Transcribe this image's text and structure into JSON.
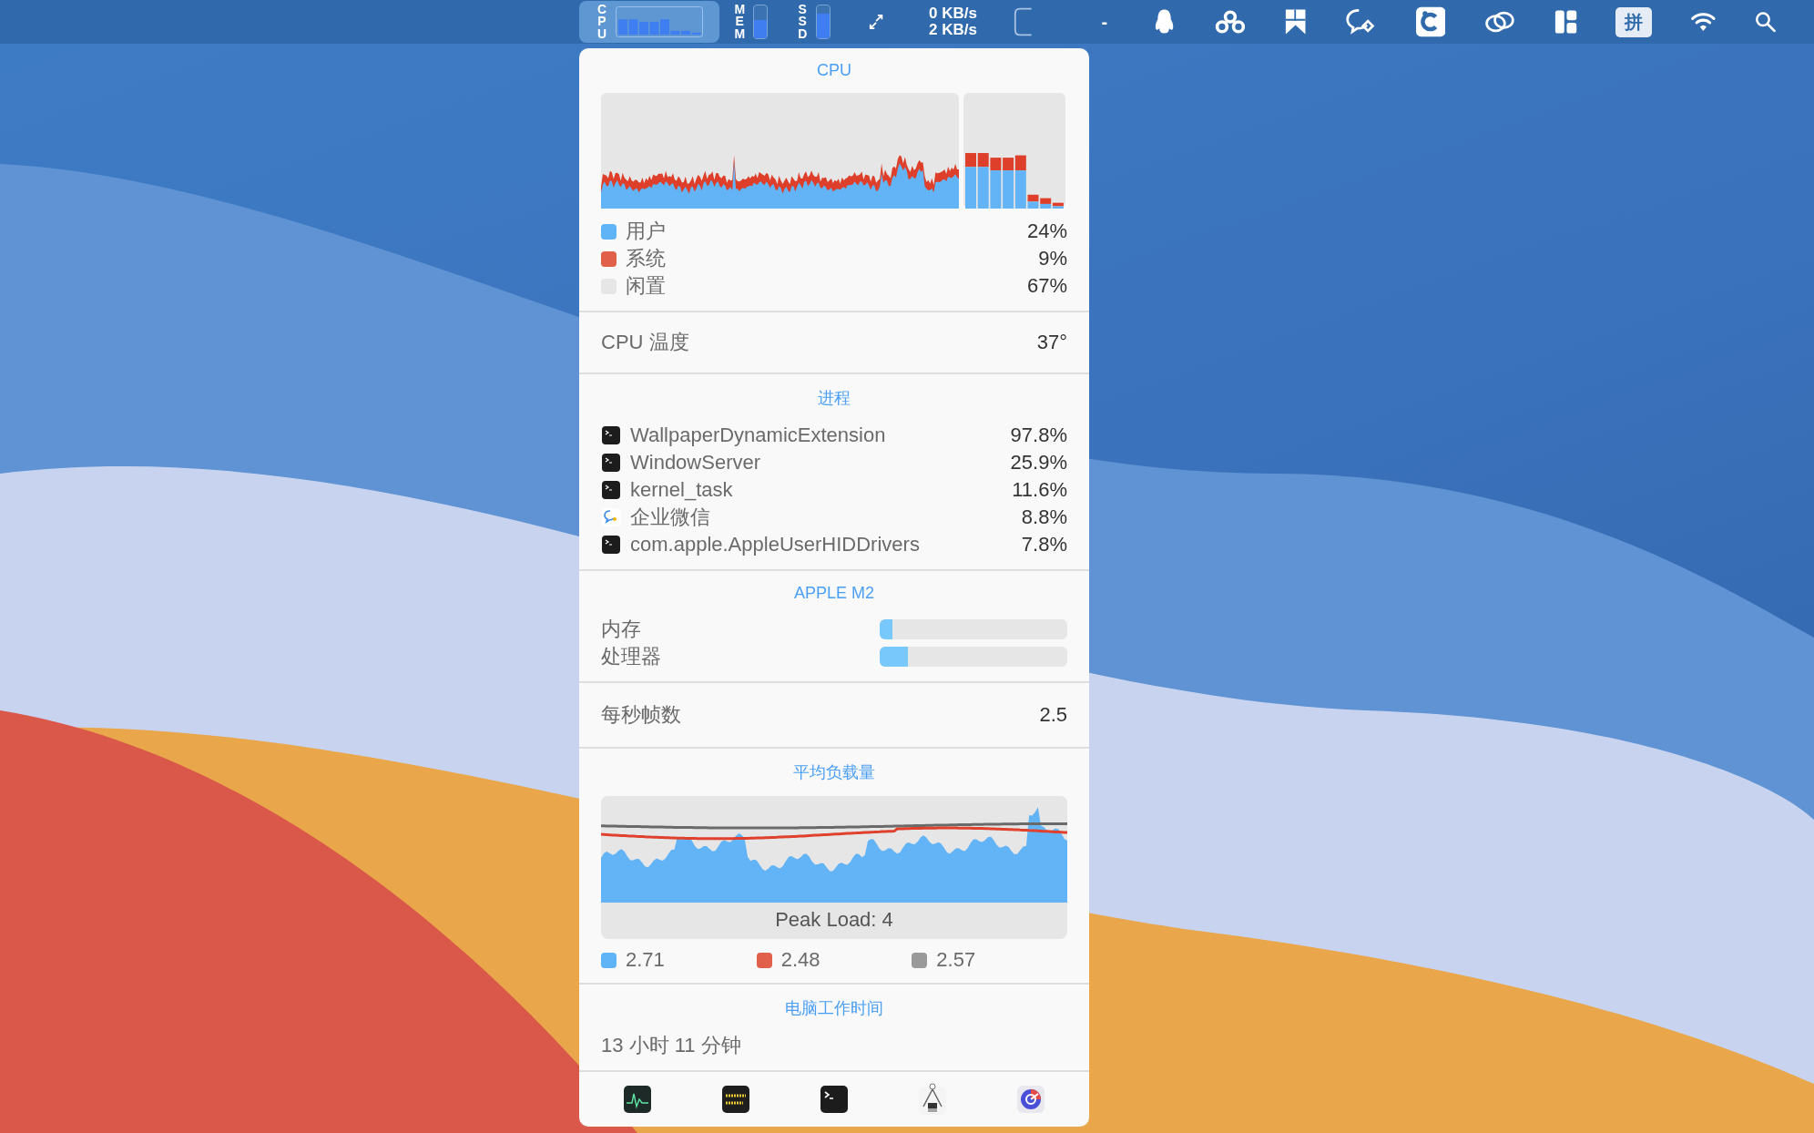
{
  "menu_bar": {
    "cpu": {
      "label": "CPU"
    },
    "mem": {
      "label": "MEM",
      "level": 0.55
    },
    "ssd": {
      "label": "SSD",
      "level": 0.75
    },
    "network": {
      "upload": "0 KB/s",
      "download": "2 KB/s"
    },
    "dash": "-",
    "input_method": "拼"
  },
  "panel": {
    "cpu": {
      "title": "CPU",
      "legend": [
        {
          "label": "用户",
          "value": "24%",
          "color": "#5fb4f7"
        },
        {
          "label": "系统",
          "value": "9%",
          "color": "#e0604a"
        },
        {
          "label": "闲置",
          "value": "67%",
          "color": "#e6e6e6"
        }
      ]
    },
    "temperature": {
      "label": "CPU 温度",
      "value": "37°"
    },
    "processes": {
      "title": "进程",
      "items": [
        {
          "name": "WallpaperDynamicExtension",
          "value": "97.8%",
          "kind": "terminal"
        },
        {
          "name": "WindowServer",
          "value": "25.9%",
          "kind": "terminal"
        },
        {
          "name": "kernel_task",
          "value": "11.6%",
          "kind": "terminal"
        },
        {
          "name": "企业微信",
          "value": "8.8%",
          "kind": "chat"
        },
        {
          "name": "com.apple.AppleUserHIDDrivers",
          "value": "7.8%",
          "kind": "terminal"
        }
      ]
    },
    "chip": {
      "title": "APPLE M2",
      "meters": [
        {
          "label": "内存",
          "level": 0.07
        },
        {
          "label": "处理器",
          "level": 0.15
        }
      ]
    },
    "fps": {
      "label": "每秒帧数",
      "value": "2.5"
    },
    "load": {
      "title": "平均负载量",
      "peak": "Peak Load: 4",
      "legend": [
        {
          "value": "2.71",
          "color": "#5fb4f7"
        },
        {
          "value": "2.48",
          "color": "#e0604a"
        },
        {
          "value": "2.57",
          "color": "#9a9a9a"
        }
      ]
    },
    "uptime": {
      "title": "电脑工作时间",
      "value": "13 小时 11 分钟"
    }
  }
}
